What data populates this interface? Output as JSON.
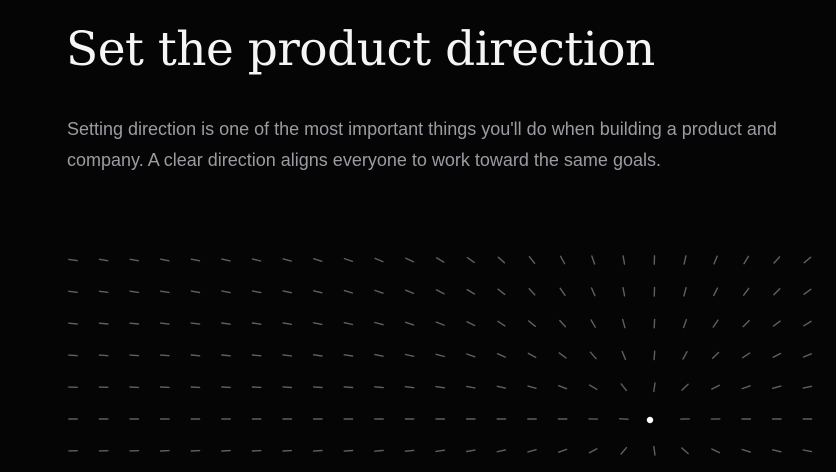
{
  "section": {
    "title": "Set the product direction",
    "description": "Setting direction is one of the most important things you'll do when building a product and company. A clear direction aligns everyone to work toward the same goals."
  },
  "colors": {
    "background": "#050505",
    "title": "#f5f5f5",
    "description": "#9b9ba2",
    "dash": "#5f5f65",
    "focus_dot": "#ffffff"
  }
}
